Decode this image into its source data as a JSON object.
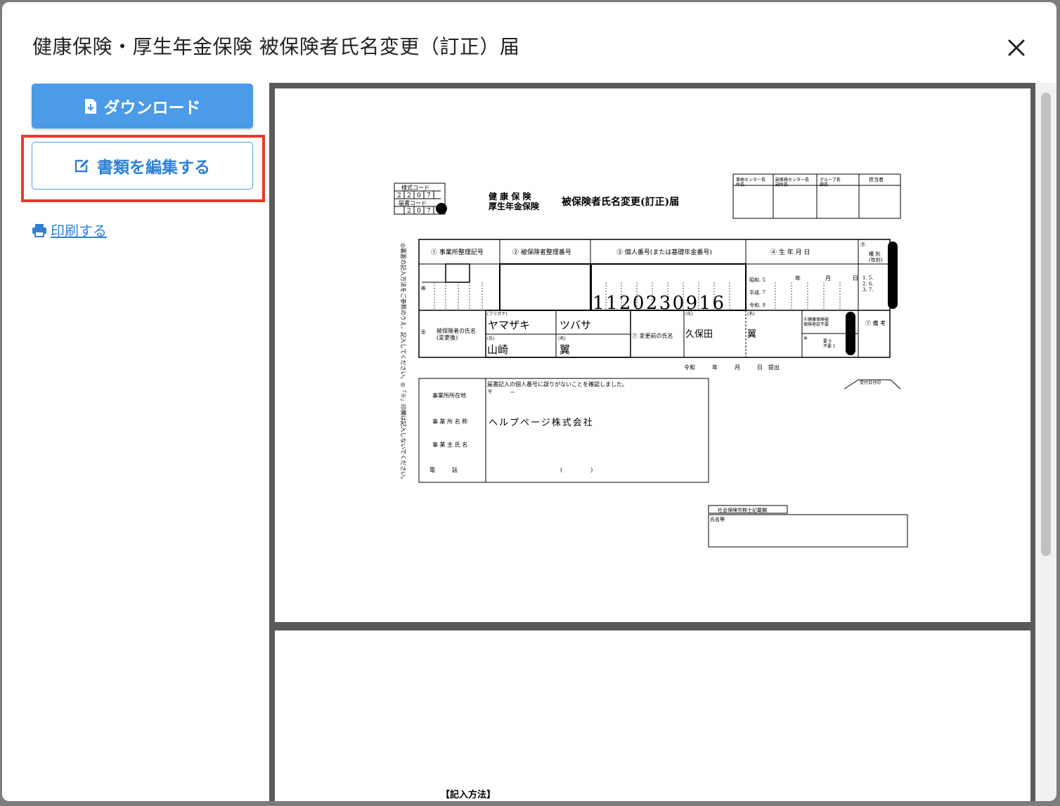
{
  "modal": {
    "title": "健康保険・厚生年金保険 被保険者氏名変更（訂正）届",
    "close_glyph": "✕"
  },
  "actions": {
    "download_label": "ダウンロード",
    "edit_label": "書類を編集する",
    "print_label": "印刷する"
  },
  "colors": {
    "accent": "#4b9be8",
    "highlight": "#e63b2e",
    "link": "#2f80d6"
  },
  "form": {
    "style_code_label": "様式コード",
    "style_code": [
      "2",
      "2",
      "0",
      "7"
    ],
    "notice_code_label": "届書コード",
    "notice_code": [
      "2",
      "0",
      "7"
    ],
    "title_left_1": "健 康 保 険",
    "title_left_2": "厚生年金保険",
    "title_main": "被保険者氏名変更(訂正)届",
    "approval_headers": [
      "事務センター長\n所長",
      "副事務センター長\n副所長",
      "グループ長\n課長",
      "担当者"
    ],
    "side_note": "◎裏面の記入方法をご参照のうえ、記入してください。◎「※」印欄は記入しないでください。",
    "col1": "① 事業所整理記号",
    "col2": "② 被保険者整理番号",
    "col3": "③ 個人番号(または基礎年金番号)",
    "col4": "④ 生 年 月 日",
    "col5_head": "⑦",
    "col5": "種 別\n(性別)",
    "era_showa": "昭和. 5",
    "era_heisei": "平成. 7",
    "era_reiwa": "令和. 9",
    "year": "年",
    "month": "月",
    "day": "日",
    "kind_options": "1.  5.\n2.  6.\n3.  7.",
    "asterisk": "※",
    "personal_number": "1120230916",
    "name_label_num": "⑤",
    "name_label": "被保険者の氏名\n(変更後)",
    "furigana_label": "(フリガナ)",
    "kana_last": "ヤマザキ",
    "kana_first": "ツバサ",
    "kanji_last_label": "(氏)",
    "kanji_first_label": "(名)",
    "kanji_last": "山崎",
    "kanji_first": "翼",
    "prev_name_label": "⑦ 変更前の氏名",
    "prev_last_label": "(氏)",
    "prev_first_label": "(名)",
    "prev_last": "久保田",
    "prev_first": "翼",
    "card_label": "⑥健康保険被\n保険者証不要",
    "card_opts": "要 0\n不要 1",
    "remarks": "⑦ 備 考",
    "submit_line": "令和　　　年　　　月　　　日　提出",
    "receipt": "受付日付印",
    "confirm": "届書記入の個人番号に誤りがないことを確認しました。",
    "postal": "〒　　　－",
    "addr_label": "事業所所在地",
    "office_label": "事 業 所 名 称",
    "office_name": "ヘルプページ株式会社",
    "owner_label": "事 業 主 氏 名",
    "phone_label": "電　　　話",
    "phone_paren": "(　　　　　)",
    "sharoushi_head": "社会保険労務士記載欄",
    "sharoushi_name": "氏名等",
    "page2_heading": "【記入方法】"
  }
}
